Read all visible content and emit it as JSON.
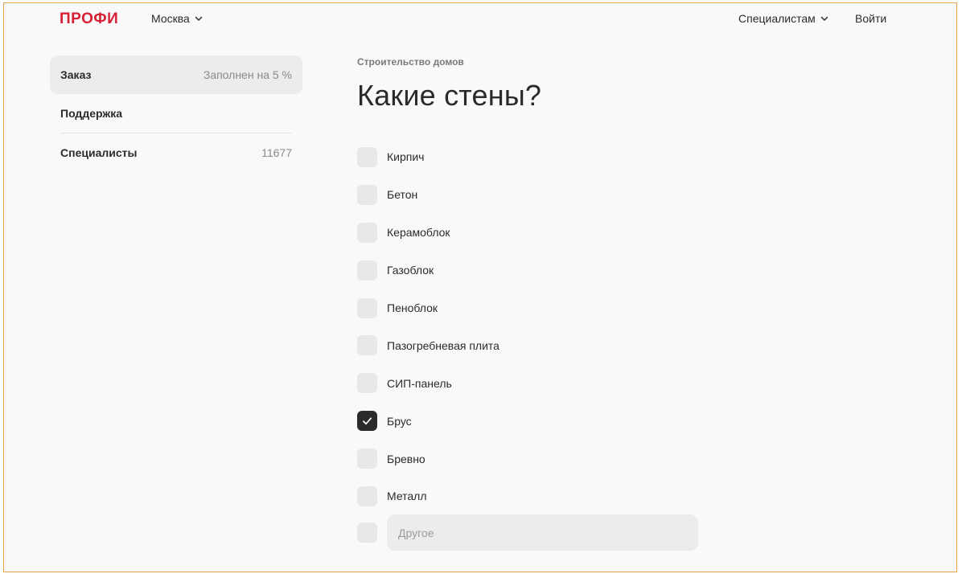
{
  "header": {
    "logo": "ПРОФИ",
    "city": "Москва",
    "for_specialists": "Специалистам",
    "login": "Войти"
  },
  "sidebar": {
    "items": [
      {
        "label": "Заказ",
        "value": "Заполнен на 5 %",
        "active": true
      },
      {
        "label": "Поддержка",
        "value": ""
      },
      {
        "label": "Специалисты",
        "value": "11677"
      }
    ]
  },
  "main": {
    "breadcrumb": "Строительство домов",
    "title": "Какие стены?",
    "options": [
      {
        "label": "Кирпич",
        "checked": false
      },
      {
        "label": "Бетон",
        "checked": false
      },
      {
        "label": "Керамоблок",
        "checked": false
      },
      {
        "label": "Газоблок",
        "checked": false
      },
      {
        "label": "Пеноблок",
        "checked": false
      },
      {
        "label": "Пазогребневая плита",
        "checked": false
      },
      {
        "label": "СИП-панель",
        "checked": false
      },
      {
        "label": "Брус",
        "checked": true
      },
      {
        "label": "Бревно",
        "checked": false
      },
      {
        "label": "Металл",
        "checked": false
      }
    ],
    "other": {
      "placeholder": "Другое",
      "value": ""
    }
  },
  "colors": {
    "brand": "#d72035",
    "checkbox_checked": "#2b2b2b",
    "checkbox_unchecked": "#e8e8e8"
  }
}
